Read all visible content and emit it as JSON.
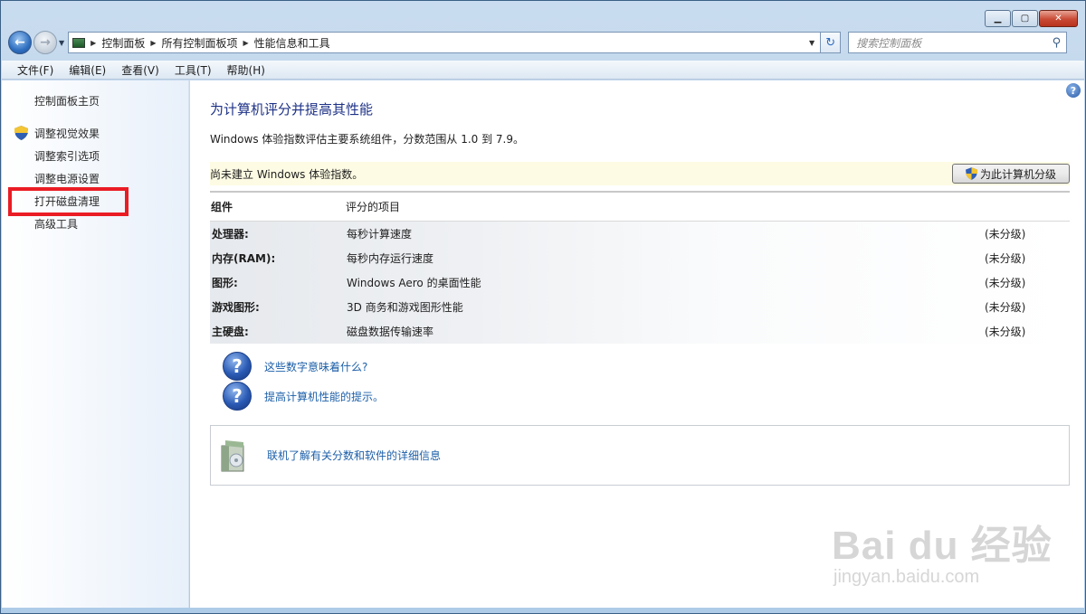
{
  "window": {
    "minimize": "▁",
    "maximize": "▢",
    "close": "✕"
  },
  "nav": {
    "back_icon": "arrow-left-icon",
    "forward_icon": "arrow-right-icon",
    "breadcrumbs": [
      "控制面板",
      "所有控制面板项",
      "性能信息和工具"
    ],
    "search_placeholder": "搜索控制面板"
  },
  "menu": [
    "文件(F)",
    "编辑(E)",
    "查看(V)",
    "工具(T)",
    "帮助(H)"
  ],
  "sidebar": {
    "home": "控制面板主页",
    "items": [
      "调整视觉效果",
      "调整索引选项",
      "调整电源设置",
      "打开磁盘清理",
      "高级工具"
    ]
  },
  "main": {
    "title": "为计算机评分并提高其性能",
    "description": "Windows 体验指数评估主要系统组件，分数范围从 1.0 到 7.9。",
    "notice": "尚未建立 Windows 体验指数。",
    "rate_button": "为此计算机分级",
    "table": {
      "col1": "组件",
      "col2": "评分的项目",
      "rows": [
        {
          "component": "处理器:",
          "item": "每秒计算速度",
          "score": "(未分级)"
        },
        {
          "component": "内存(RAM):",
          "item": "每秒内存运行速度",
          "score": "(未分级)"
        },
        {
          "component": "图形:",
          "item": "Windows Aero 的桌面性能",
          "score": "(未分级)"
        },
        {
          "component": "游戏图形:",
          "item": "3D 商务和游戏图形性能",
          "score": "(未分级)"
        },
        {
          "component": "主硬盘:",
          "item": "磁盘数据传输速率",
          "score": "(未分级)"
        }
      ]
    },
    "links": [
      "这些数字意味着什么?",
      "提高计算机性能的提示。"
    ],
    "info_link": "联机了解有关分数和软件的详细信息"
  },
  "watermark": {
    "logo": "Bai du 经验",
    "url": "jingyan.baidu.com"
  }
}
